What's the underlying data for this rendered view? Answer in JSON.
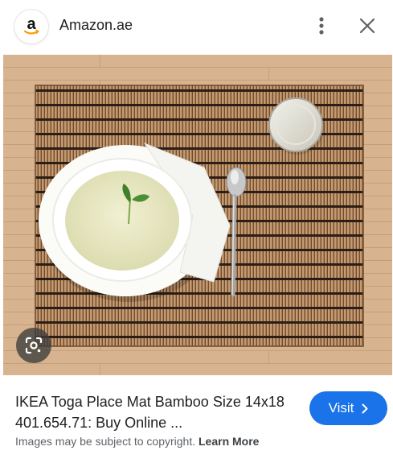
{
  "header": {
    "logo_letter": "a",
    "site_name": "Amazon.ae",
    "menu_icon": "more-vert-icon",
    "close_icon": "close-icon"
  },
  "image": {
    "description_icon": "google-lens-icon"
  },
  "result": {
    "title": "IKEA Toga Place Mat Bamboo Size 14x18 401.654.71: Buy Online ...",
    "visit_label": "Visit",
    "visit_icon": "chevron-right-icon"
  },
  "footer": {
    "copyright_text": "Images may be subject to copyright.",
    "learn_more_label": "Learn More"
  },
  "colors": {
    "accent": "#1a73e8",
    "amazon_orange": "#ff9900"
  }
}
